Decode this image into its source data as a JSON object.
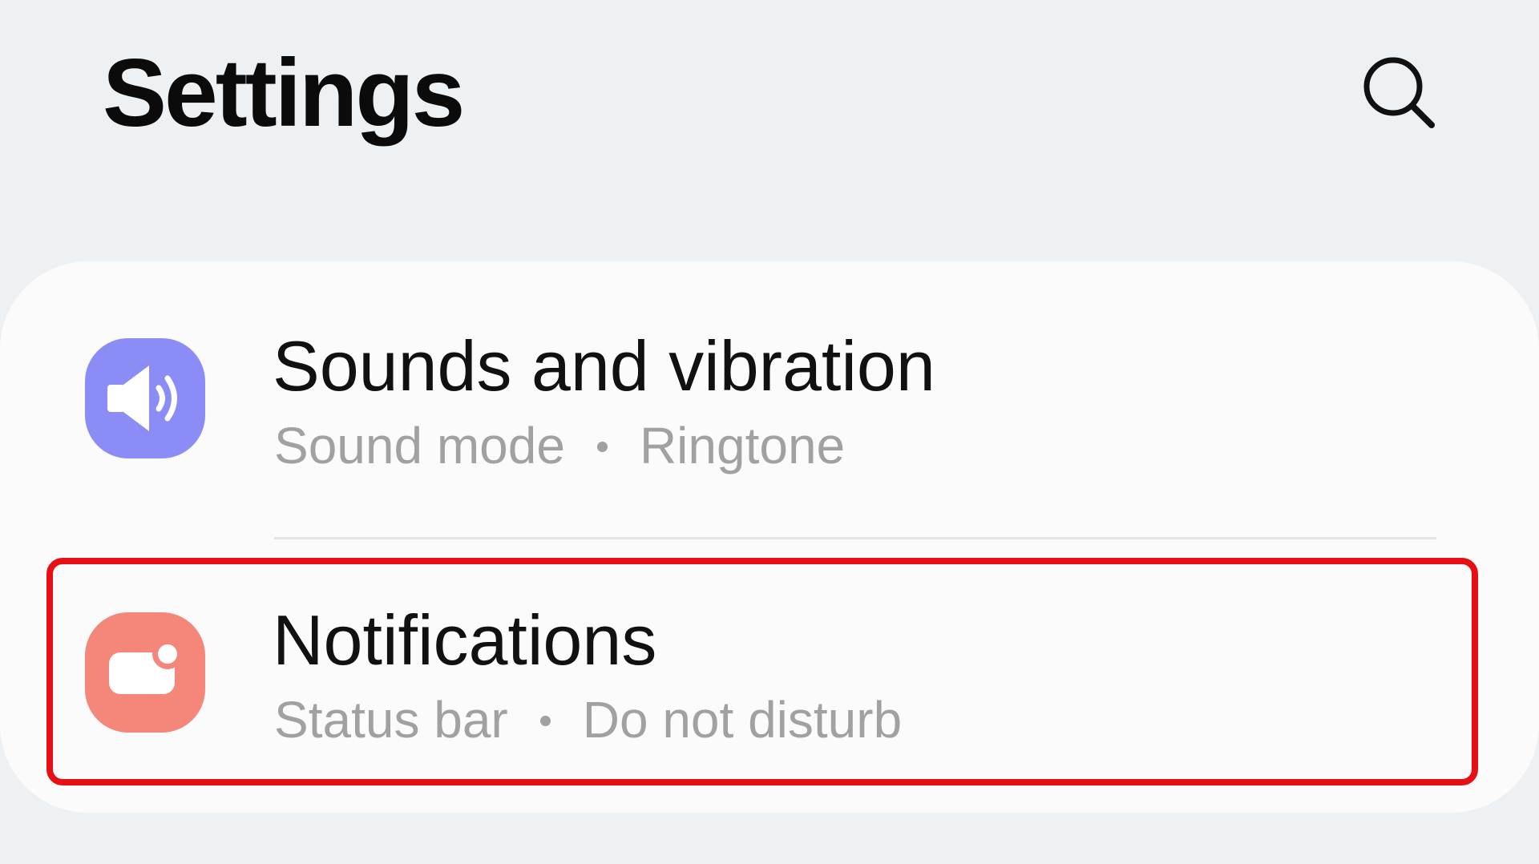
{
  "header": {
    "title": "Settings",
    "search_icon": "search-icon"
  },
  "settings_list": {
    "items": [
      {
        "title": "Sounds and vibration",
        "subtitle_parts": [
          "Sound mode",
          "Ringtone"
        ],
        "icon": "speaker-icon",
        "icon_color": "#8b8cf6"
      },
      {
        "title": "Notifications",
        "subtitle_parts": [
          "Status bar",
          "Do not disturb"
        ],
        "icon": "notification-icon",
        "icon_color": "#f4867a",
        "highlighted": true
      }
    ]
  },
  "colors": {
    "background": "#edf1f4",
    "card": "#fbfbfb",
    "highlight": "#e80f14",
    "title_text": "#111111",
    "subtitle_text": "#a1a1a1"
  }
}
